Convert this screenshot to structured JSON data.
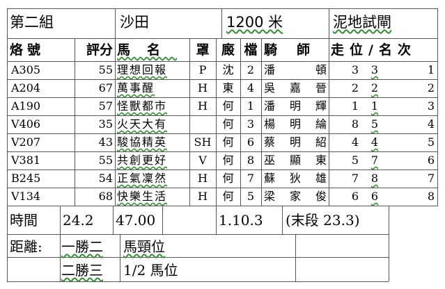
{
  "meta": {
    "group": "第二組",
    "venue": "沙田",
    "distance": "1200 米",
    "track": "泥地試閘"
  },
  "columns": {
    "brand": "烙號",
    "rating": "評分",
    "horse": "馬名",
    "gear": "罩",
    "trainer": "廄",
    "draw": "檔",
    "jockey": "騎師",
    "running": "走位/名次"
  },
  "rows": [
    {
      "brand": "A305",
      "rating": "55",
      "horse": "理想回報",
      "gear": "P",
      "trainer": "沈",
      "draw": "2",
      "jockey": "潘頓",
      "pos1": "3",
      "pos2": "3",
      "place": "1"
    },
    {
      "brand": "A204",
      "rating": "67",
      "horse": "萬事醒",
      "gear": "H",
      "trainer": "東",
      "draw": "4",
      "jockey": "吳嘉晉",
      "pos1": "2",
      "pos2": "2",
      "place": "2"
    },
    {
      "brand": "A190",
      "rating": "57",
      "horse": "怪獸都市",
      "gear": "H",
      "trainer": "何",
      "draw": "1",
      "jockey": "潘明輝",
      "pos1": "1",
      "pos2": "1",
      "place": "3"
    },
    {
      "brand": "V406",
      "rating": "35",
      "horse": "火天大有",
      "gear": "",
      "trainer": "何",
      "draw": "3",
      "jockey": "楊明綸",
      "pos1": "8",
      "pos2": "5",
      "place": "4"
    },
    {
      "brand": "V207",
      "rating": "43",
      "horse": "駿協精英",
      "gear": "SH",
      "trainer": "何",
      "draw": "6",
      "jockey": "蔡明紹",
      "pos1": "4",
      "pos2": "4",
      "place": "5"
    },
    {
      "brand": "V381",
      "rating": "55",
      "horse": "共創更好",
      "gear": "V",
      "trainer": "何",
      "draw": "8",
      "jockey": "巫顯東",
      "pos1": "5",
      "pos2": "7",
      "place": "6"
    },
    {
      "brand": "B245",
      "rating": "54",
      "horse": "正氣凜然",
      "gear": "H",
      "trainer": "何",
      "draw": "7",
      "jockey": "蘇狄雄",
      "pos1": "7",
      "pos2": "8",
      "place": "7"
    },
    {
      "brand": "V134",
      "rating": "68",
      "horse": "快樂生活",
      "gear": "H",
      "trainer": "何",
      "draw": "5",
      "jockey": "梁家俊",
      "pos1": "6",
      "pos2": "6",
      "place": "8"
    }
  ],
  "times": {
    "label": "時間",
    "t1": "24.2",
    "t2": "47.00",
    "t3": "1.10.3",
    "last": "(末段 23.3)"
  },
  "margins": {
    "label": "距離:",
    "first_label": "一勝二",
    "first_value": "馬頸位",
    "second_label": "二勝三",
    "second_value": "1/2 馬位"
  }
}
